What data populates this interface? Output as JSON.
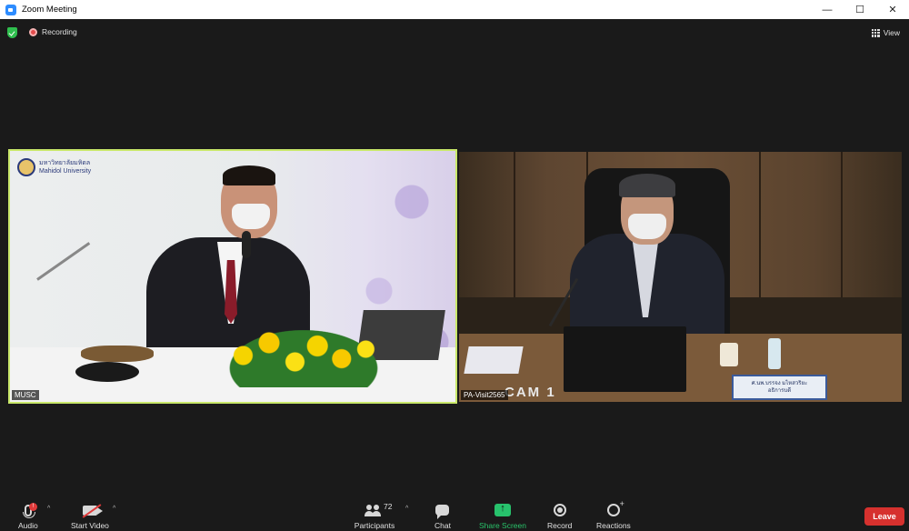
{
  "window": {
    "title": "Zoom Meeting",
    "controls": [
      "—",
      "☐",
      "✕"
    ]
  },
  "status": {
    "recording_label": "Recording",
    "view_label": "View"
  },
  "tiles": [
    {
      "participant": "MUSC",
      "logo_text_line1": "มหาวิทยาลัยมหิดล",
      "logo_text_line2": "Mahidol University",
      "active_speaker": true
    },
    {
      "participant": "PA-Visit2565",
      "overlay_text": "CAM 1",
      "nameplate_line1": "ศ.นพ.บรรจง มไหสวริยะ",
      "nameplate_line2": "อธิการบดี"
    }
  ],
  "toolbar": {
    "audio_label": "Audio",
    "audio_badge": "!",
    "video_label": "Start Video",
    "participants_label": "Participants",
    "participants_count": "72",
    "chat_label": "Chat",
    "share_label": "Share Screen",
    "record_label": "Record",
    "reactions_label": "Reactions",
    "caret": "^",
    "leave_label": "Leave"
  },
  "colors": {
    "active_speaker_border": "#c9e86a",
    "share_green": "#29c36a",
    "leave_red": "#d6312e",
    "toolbar_bg": "#1a1a1a"
  }
}
